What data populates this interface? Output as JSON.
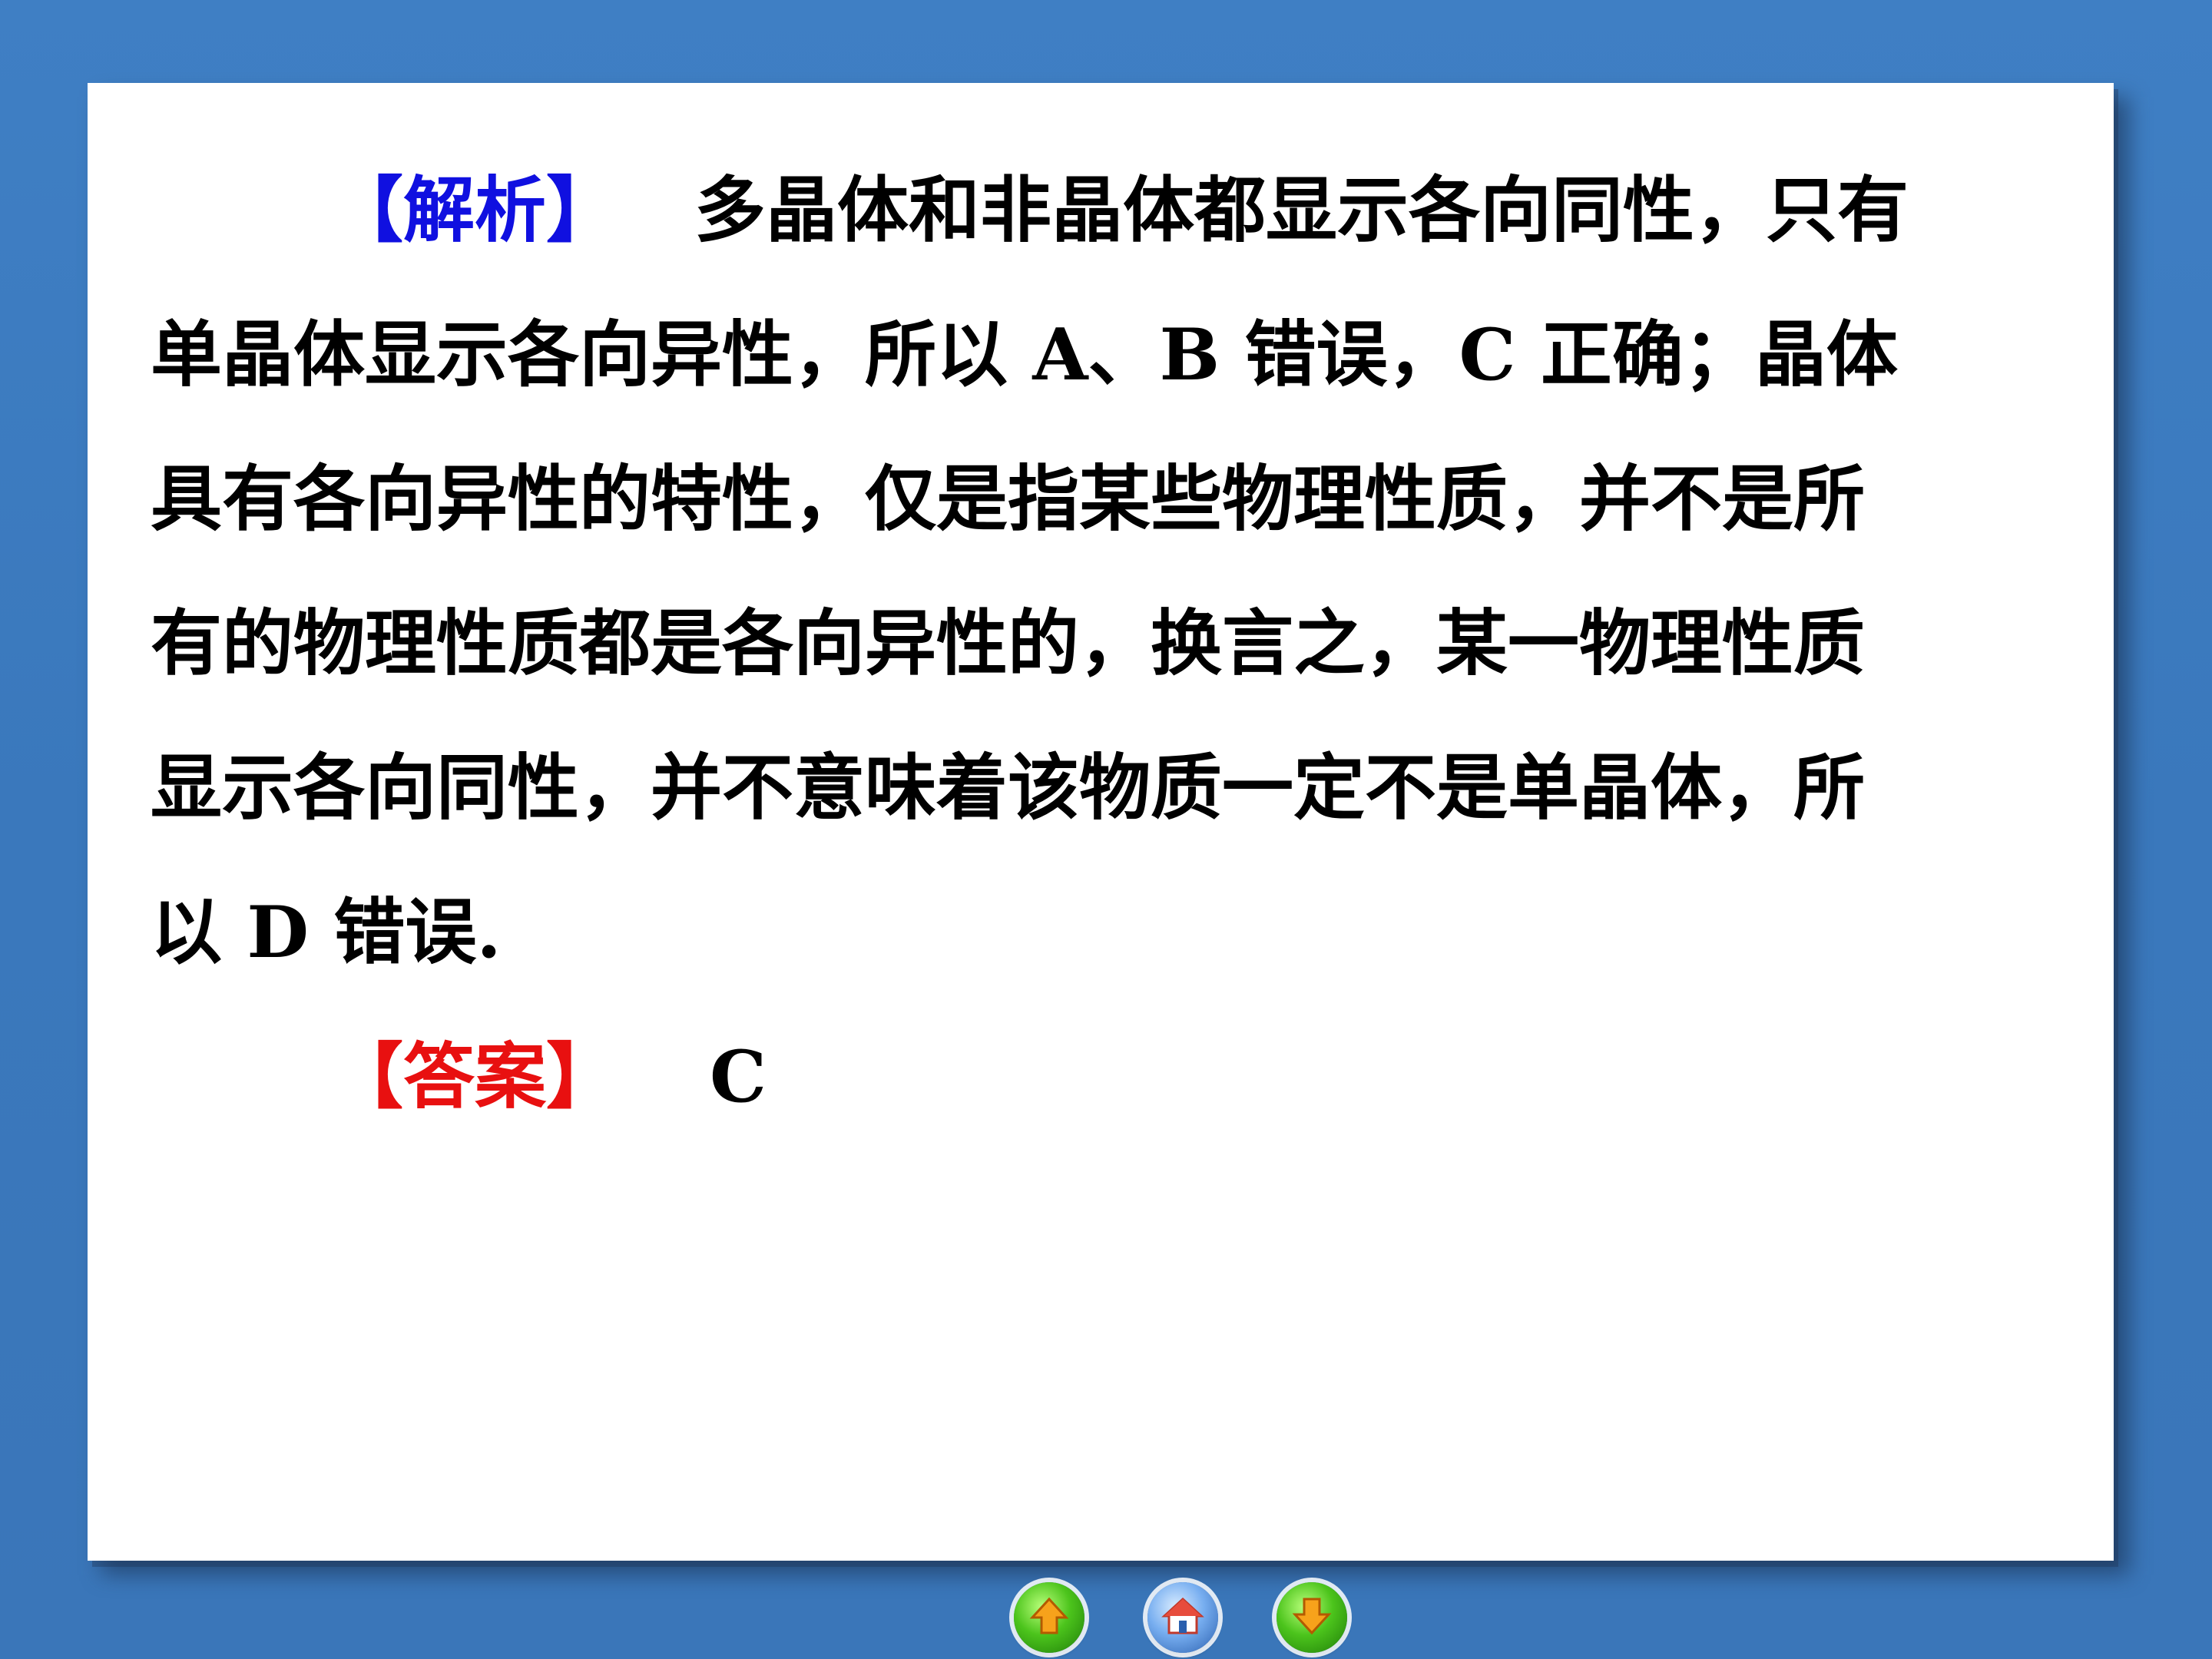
{
  "slide": {
    "analysis_tag": "【解析】",
    "analysis_lines": [
      "多晶体和非晶体都显示各向同性，只有",
      "单晶体显示各向异性，所以 A、B 错误，C 正确；晶体",
      "具有各向异性的特性，仅是指某些物理性质，并不是所",
      "有的物理性质都是各向异性的，换言之，某一物理性质",
      "显示各向同性，并不意味着该物质一定不是单晶体，所",
      "以 D 错误."
    ],
    "answer_tag": "【答案】",
    "answer_value": "C",
    "colors": {
      "analysis_tag": "#1010e0",
      "answer_tag": "#e81010",
      "background": "#3d7bbf"
    }
  },
  "nav": {
    "prev_icon": "up-arrow-icon",
    "home_icon": "home-icon",
    "next_icon": "down-arrow-icon"
  }
}
